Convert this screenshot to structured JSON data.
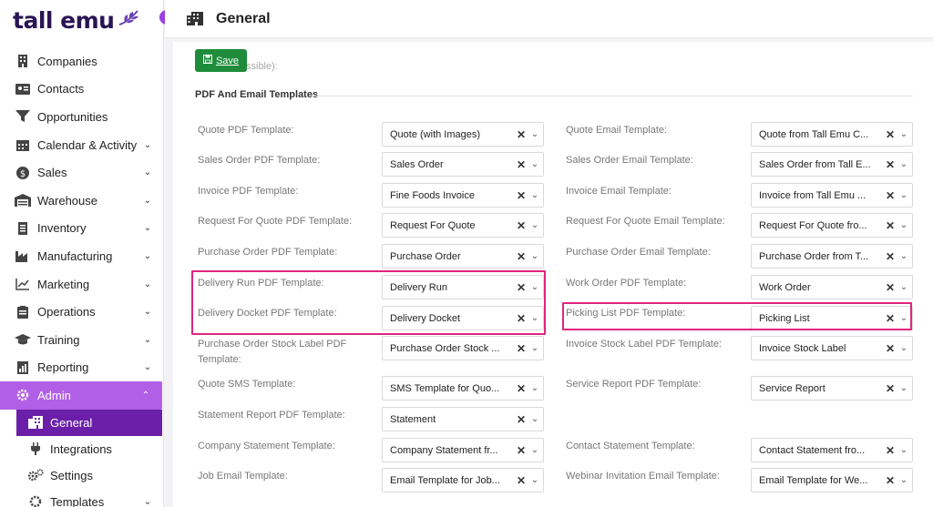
{
  "app": {
    "logo_text": "tall emu"
  },
  "header": {
    "title": "General"
  },
  "sidebar": {
    "items": [
      {
        "label": "Companies",
        "icon": "building-icon",
        "chevron": false
      },
      {
        "label": "Contacts",
        "icon": "contact-card-icon",
        "chevron": false
      },
      {
        "label": "Opportunities",
        "icon": "funnel-icon",
        "chevron": false
      },
      {
        "label": "Calendar & Activity",
        "icon": "calendar-icon",
        "chevron": true
      },
      {
        "label": "Sales",
        "icon": "dollar-icon",
        "chevron": true
      },
      {
        "label": "Warehouse",
        "icon": "warehouse-icon",
        "chevron": true
      },
      {
        "label": "Inventory",
        "icon": "inventory-icon",
        "chevron": true
      },
      {
        "label": "Manufacturing",
        "icon": "factory-icon",
        "chevron": true
      },
      {
        "label": "Marketing",
        "icon": "chart-line-icon",
        "chevron": true
      },
      {
        "label": "Operations",
        "icon": "clipboard-icon",
        "chevron": true
      },
      {
        "label": "Training",
        "icon": "graduation-cap-icon",
        "chevron": true
      },
      {
        "label": "Reporting",
        "icon": "report-icon",
        "chevron": true
      },
      {
        "label": "Admin",
        "icon": "gear-icon",
        "chevron": true
      }
    ],
    "admin_sub": [
      {
        "label": "General",
        "icon": "building-icon"
      },
      {
        "label": "Integrations",
        "icon": "plug-icon"
      },
      {
        "label": "Settings",
        "icon": "gears-icon"
      },
      {
        "label": "Templates",
        "icon": "template-icon"
      }
    ]
  },
  "toolbar": {
    "save_label": "Save",
    "faded_text": "ssible):"
  },
  "section": {
    "title": "PDF And Email Templates"
  },
  "fields_left": [
    {
      "label": "Quote PDF Template:",
      "value": "Quote (with Images)"
    },
    {
      "label": "Sales Order PDF Template:",
      "value": "Sales Order"
    },
    {
      "label": "Invoice PDF Template:",
      "value": "Fine Foods Invoice"
    },
    {
      "label": "Request For Quote PDF Template:",
      "value": "Request For Quote"
    },
    {
      "label": "Purchase Order PDF Template:",
      "value": "Purchase Order"
    },
    {
      "label": "Delivery Run PDF Template:",
      "value": "Delivery Run"
    },
    {
      "label": "Delivery Docket PDF Template:",
      "value": "Delivery Docket"
    },
    {
      "label": "Purchase Order Stock Label PDF Template:",
      "value": "Purchase Order Stock ..."
    },
    {
      "label": "Quote SMS Template:",
      "value": "SMS Template for Quo..."
    },
    {
      "label": "Statement Report PDF Template:",
      "value": "Statement"
    },
    {
      "label": "Company Statement Template:",
      "value": "Company Statement fr..."
    },
    {
      "label": "Job Email Template:",
      "value": "Email Template for Job..."
    }
  ],
  "fields_right": [
    {
      "label": "Quote Email Template:",
      "value": "Quote from Tall Emu C..."
    },
    {
      "label": "Sales Order Email Template:",
      "value": "Sales Order from Tall E..."
    },
    {
      "label": "Invoice Email Template:",
      "value": "Invoice from Tall Emu ..."
    },
    {
      "label": "Request For Quote Email Template:",
      "value": "Request For Quote fro..."
    },
    {
      "label": "Purchase Order Email Template:",
      "value": "Purchase Order from T..."
    },
    {
      "label": "Work Order PDF Template:",
      "value": "Work Order"
    },
    {
      "label": "Picking List PDF Template:",
      "value": "Picking List"
    },
    {
      "label": "Invoice Stock Label PDF Template:",
      "value": "Invoice Stock Label"
    },
    {
      "label": "Service Report PDF Template:",
      "value": "Service Report"
    },
    {
      "label": "",
      "value": ""
    },
    {
      "label": "Contact Statement Template:",
      "value": "Contact Statement fro..."
    },
    {
      "label": "Webinar Invitation Email Template:",
      "value": "Email Template for We..."
    }
  ],
  "glyphs": {
    "clear": "✕",
    "dropdown": "⌄",
    "chevron_down": "⌄",
    "chevron_up": "⌃",
    "collapse": "‹"
  },
  "colors": {
    "accent": "#b25fe8",
    "accent_dark": "#6b1fa8",
    "save": "#1e8c3a",
    "highlight": "#e0257e"
  }
}
